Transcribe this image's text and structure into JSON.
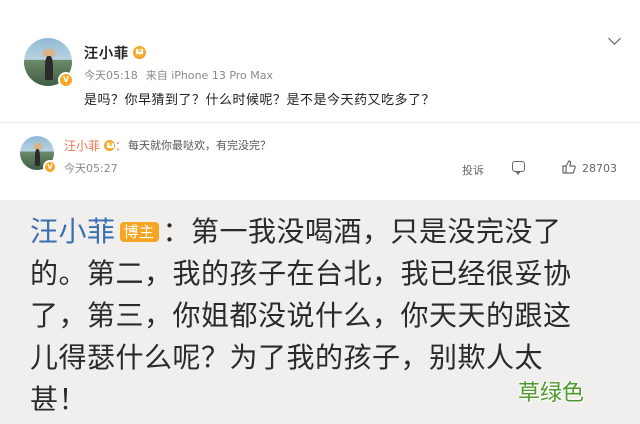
{
  "post": {
    "author": "汪小菲",
    "time": "今天05:18",
    "source": "来自 iPhone 13 Pro Max",
    "text": "是吗？你早猜到了？什么时候呢？是不是今天药又吃多了？"
  },
  "comment": {
    "author": "汪小菲",
    "text": "每天就你最哒欢，有完没完？",
    "time": "今天05:27",
    "actions": {
      "share_label": "投诉",
      "like_count": "28703"
    }
  },
  "quote": {
    "author": "汪小菲",
    "badge": "博主",
    "text": "：第一我没喝酒，只是没完没了的。第二，我的孩子在台北，我已经很妥协了，第三，你姐都没说什么，你天天的跟这儿得瑟什么呢？为了我的孩子，别欺人太甚！"
  },
  "watermark": "草绿色",
  "colors": {
    "accent_name": "#3a6fb0",
    "comment_name": "#eb7350",
    "badge": "#f5a623",
    "watermark": "#4c9a2a",
    "quote_bg": "#f1efed"
  }
}
